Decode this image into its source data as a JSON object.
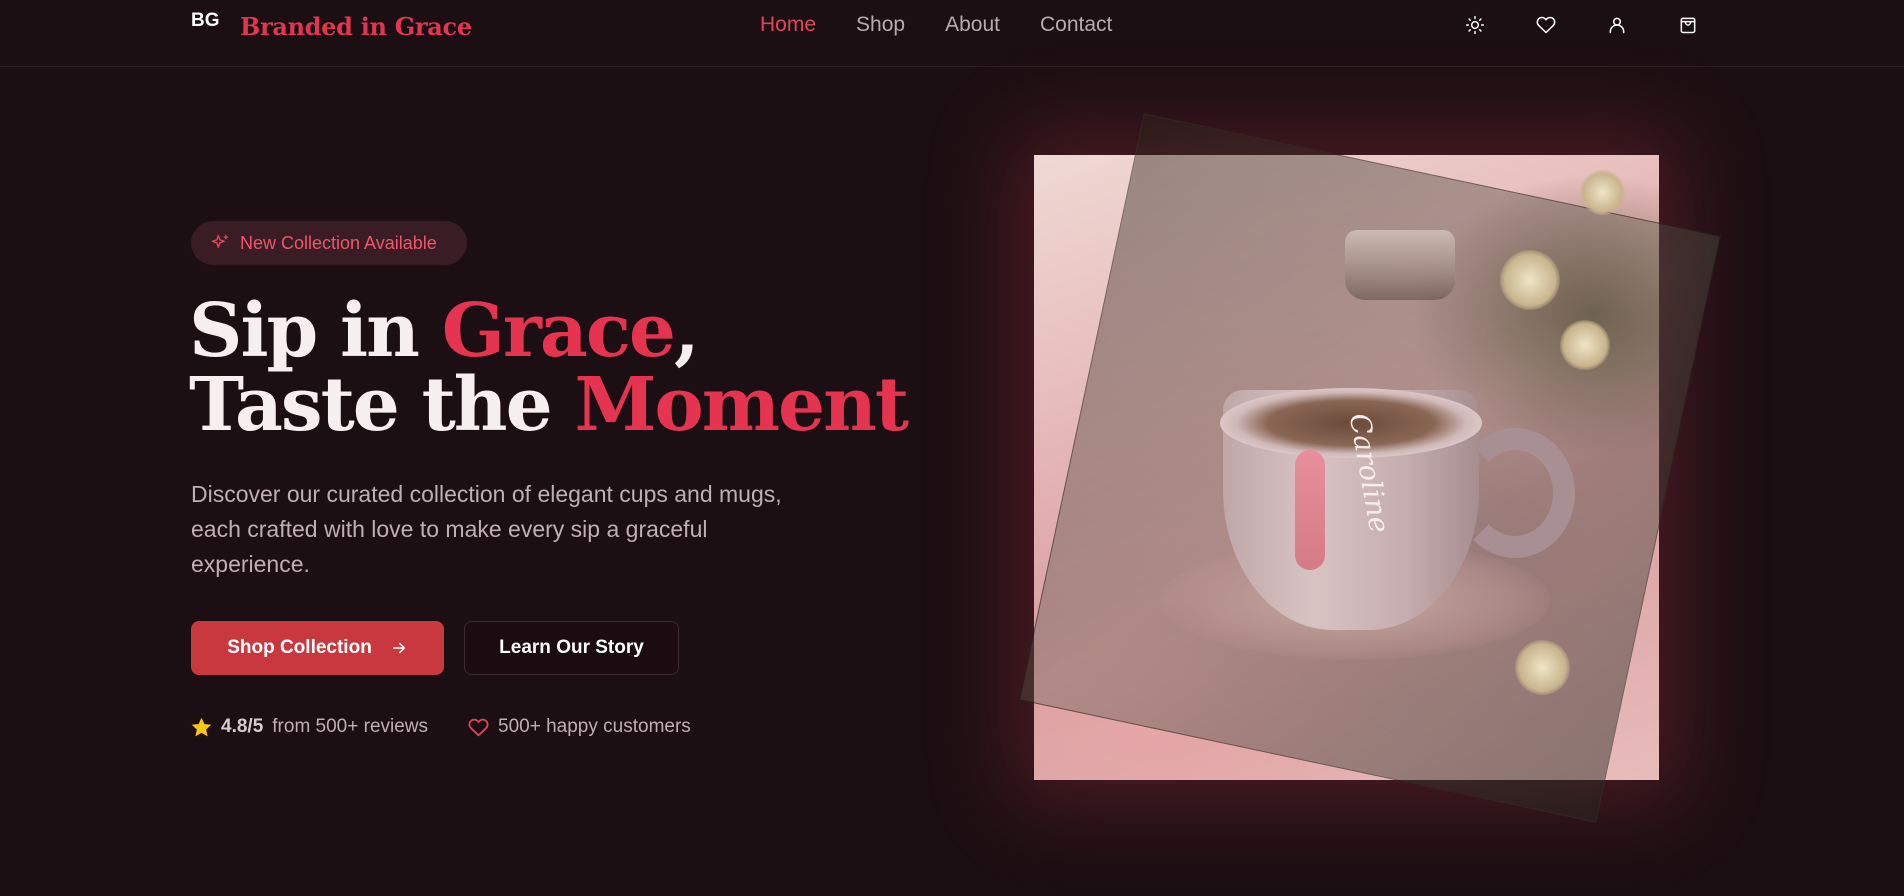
{
  "header": {
    "logo_mark": "BG",
    "brand_name": "Branded in Grace",
    "nav": [
      {
        "label": "Home",
        "active": true
      },
      {
        "label": "Shop",
        "active": false
      },
      {
        "label": "About",
        "active": false
      },
      {
        "label": "Contact",
        "active": false
      }
    ],
    "icons": [
      "sun-icon",
      "heart-icon",
      "user-icon",
      "shopping-bag-icon"
    ]
  },
  "hero": {
    "badge": "New Collection Available",
    "headline": {
      "line1_a": "Sip in ",
      "line1_accent": "Grace",
      "line1_b": ",",
      "line2_a": "Taste the ",
      "line2_accent": "Moment"
    },
    "subtitle": "Discover our curated collection of elegant cups and mugs, each crafted with love to make every sip a graceful experience.",
    "primary_button": "Shop Collection",
    "secondary_button": "Learn Our Story",
    "stats": {
      "rating": "4.8/5",
      "rating_text": "from 500+ reviews",
      "customers": "500+ happy customers"
    },
    "cup_inscription": "Caroline"
  },
  "colors": {
    "background": "#1c0f13",
    "accent": "#e5344f",
    "primary_button": "#c9383e",
    "star": "#f5c518"
  }
}
